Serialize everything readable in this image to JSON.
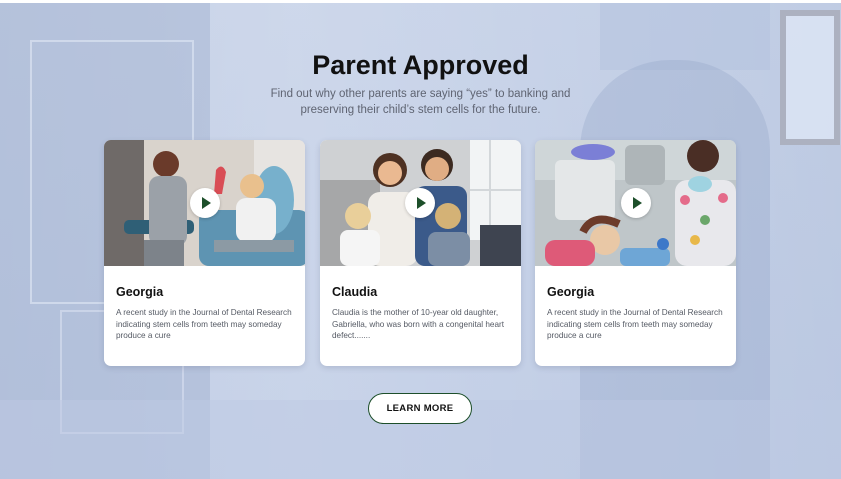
{
  "section": {
    "title": "Parent Approved",
    "subtitle": "Find out why other parents are saying “yes” to banking and preserving their child’s stem cells for the future."
  },
  "cards": [
    {
      "name": "Georgia",
      "description": "A recent study in the Journal of Dental Research indicating stem cells from teeth may someday produce a cure",
      "play_icon": "play-icon"
    },
    {
      "name": "Claudia",
      "description": "Claudia is the mother of 10-year old daughter, Gabriella, who was born with a congenital heart defect.......",
      "play_icon": "play-icon"
    },
    {
      "name": "Georgia",
      "description": "A recent study in the Journal of Dental Research indicating stem cells from teeth may someday produce a cure",
      "play_icon": "play-icon"
    }
  ],
  "cta": {
    "label": "LEARN MORE"
  },
  "colors": {
    "accent": "#1d4f2a",
    "title": "#111111",
    "overlay": "#c9d3e6"
  }
}
